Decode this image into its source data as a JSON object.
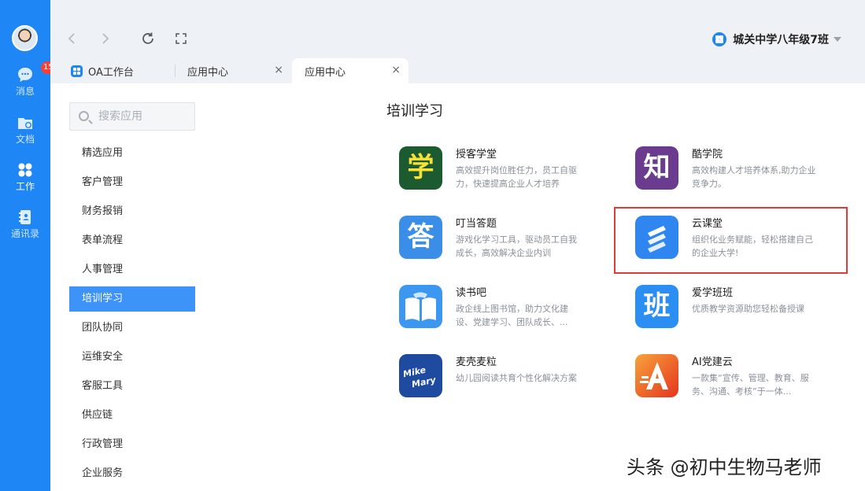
{
  "rail": {
    "items": [
      {
        "label": "消息",
        "icon": "chat-bubble-icon",
        "badge": "15"
      },
      {
        "label": "文档",
        "icon": "folder-icon"
      },
      {
        "label": "工作",
        "icon": "grid-apps-icon"
      },
      {
        "label": "通讯录",
        "icon": "contacts-book-icon"
      }
    ]
  },
  "header": {
    "org_name": "城关中学八年级7班",
    "tabs": [
      {
        "label": "OA工作台"
      },
      {
        "label": "应用中心"
      },
      {
        "label": "应用中心"
      }
    ],
    "close_glyph": "×"
  },
  "sidebar": {
    "search_placeholder": "搜索应用",
    "categories": [
      "精选应用",
      "客户管理",
      "财务报销",
      "表单流程",
      "人事管理",
      "培训学习",
      "团队协同",
      "运维安全",
      "客服工具",
      "供应链",
      "行政管理",
      "企业服务"
    ],
    "active_category": "培训学习"
  },
  "main": {
    "section_title": "培训学习",
    "apps": [
      {
        "name": "授客学堂",
        "desc": "高效提升岗位胜任力，员工自驱力，快速提高企业人才培养",
        "icon_glyph": "学",
        "color": "#1c5a2f",
        "glyph_color": "#f8e23a"
      },
      {
        "name": "酷学院",
        "desc": "高效构建人才培养体系,助力企业竞争力。",
        "icon_glyph": "知",
        "color": "#6a3b8f",
        "glyph_color": "#ffffff"
      },
      {
        "name": "叮当答题",
        "desc": "游戏化学习工具，驱动员工自我成长，高效解决企业内训",
        "icon_glyph": "答",
        "color": "#3b8ee8",
        "glyph_color": "#ffffff"
      },
      {
        "name": "云课堂",
        "desc": "组织化业务赋能，轻松搭建自己的企业大学!",
        "icon_glyph": "",
        "color": "#2f86f0",
        "glyph_color": "#ffffff"
      },
      {
        "name": "读书吧",
        "desc": "政企线上图书馆，助力文化建设、党建学习、团队成长、...",
        "icon_glyph": "",
        "color": "#3c97f0",
        "glyph_color": "#ffffff"
      },
      {
        "name": "爱学班班",
        "desc": "优质教学资源助您轻松备授课",
        "icon_glyph": "班",
        "color": "#2b8ef2",
        "glyph_color": "#ffffff"
      },
      {
        "name": "麦壳麦粒",
        "desc": "幼儿园阅读共育个性化解决方案",
        "icon_glyph": "",
        "logo_text": "Mike Mary",
        "color": "#1e4aa0",
        "glyph_color": "#ffffff"
      },
      {
        "name": "AI党建云",
        "desc": "一款集“宣传、管理、教育、服务、沟通、考核”于一体...",
        "icon_glyph": "",
        "color": "#f06a1c",
        "glyph_color": "#ffffff"
      }
    ]
  },
  "watermark": "头条 @初中生物马老师"
}
